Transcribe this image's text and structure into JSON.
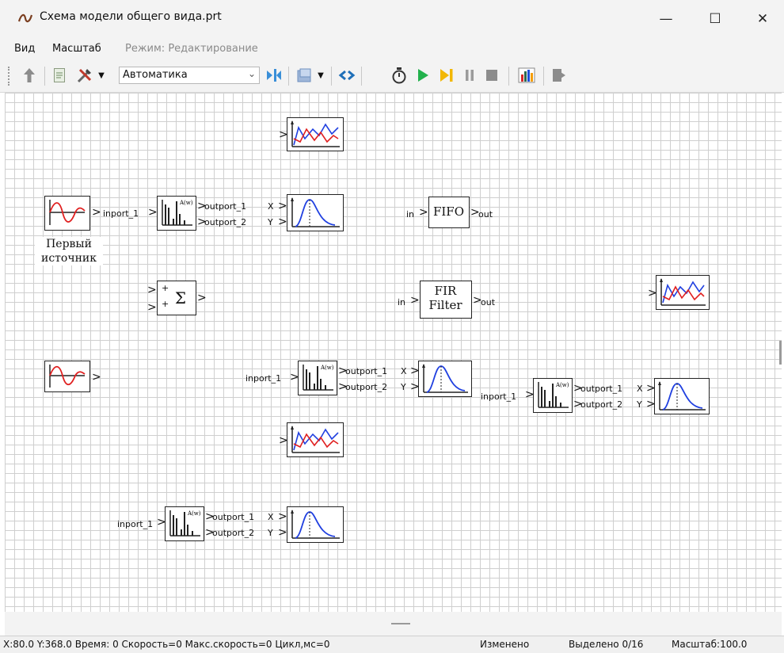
{
  "window": {
    "title": "Схема модели общего вида.prt"
  },
  "window_controls": {
    "minimize": "—",
    "maximize": "☐",
    "close": "✕"
  },
  "menu": {
    "view": "Вид",
    "scale": "Масштаб",
    "mode": "Режим: Редактирование"
  },
  "toolbar": {
    "mode_select": "Автоматика"
  },
  "blocks": {
    "source1_caption": "Первый источник",
    "fifo_label": "FIFO",
    "fir_label_1": "FIR",
    "fir_label_2": "Filter",
    "sum_symbol": "Σ",
    "spectrum_glyph": "A(w)"
  },
  "ports": {
    "inport": "inport_1",
    "outport1": "outport_1",
    "outport2": "outport_2",
    "x": "X",
    "y": "Y",
    "in": "in",
    "out": "out",
    "plus": "+"
  },
  "status": {
    "coords": "X:80.0  Y:368.0  Время: 0  Скорость=0  Макс.скорость=0  Цикл,мс=0",
    "changed": "Изменено",
    "selected": "Выделено 0/16",
    "zoom": "Масштаб:100.0"
  },
  "colors": {
    "signal_red": "#e02020",
    "signal_blue": "#2040e0",
    "play_green": "#22b14c",
    "step_yellow": "#f2b705"
  }
}
